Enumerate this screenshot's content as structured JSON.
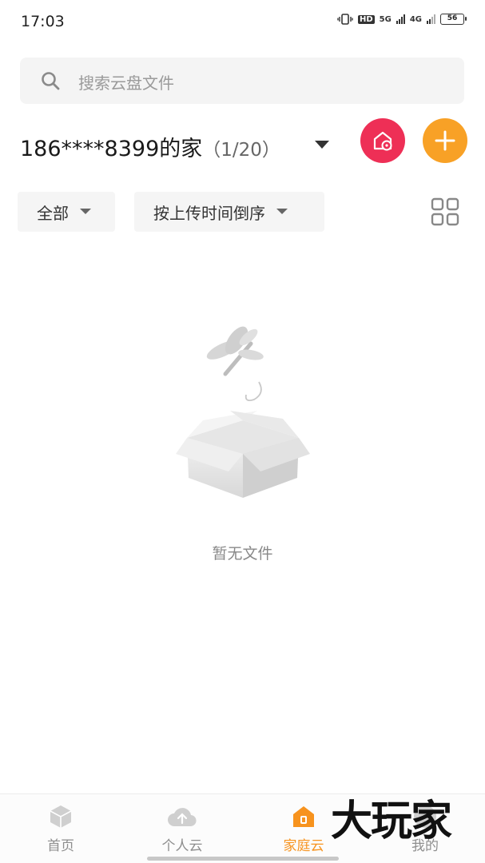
{
  "status_bar": {
    "time": "17:03",
    "hd_label": "HD",
    "net1": "5G",
    "net2": "4G",
    "battery": "56"
  },
  "search": {
    "placeholder": "搜索云盘文件",
    "icon": "search-icon"
  },
  "family": {
    "name": "186****8399的家",
    "count": "（1/20）",
    "dropdown_icon": "caret-down-icon"
  },
  "actions": {
    "home_settings_icon": "home-settings-icon",
    "add_icon": "plus-icon",
    "home_settings_color": "#ee2f56",
    "add_color": "#f8a126"
  },
  "filters": {
    "category": "全部",
    "sort": "按上传时间倒序",
    "view_toggle_icon": "grid-view-icon"
  },
  "empty_state": {
    "text": "暂无文件",
    "illustration": "empty-box-dragonfly"
  },
  "bottom_nav": {
    "items": [
      {
        "label": "首页",
        "icon": "cube-icon"
      },
      {
        "label": "个人云",
        "icon": "cloud-upload-icon"
      },
      {
        "label": "家庭云",
        "icon": "family-home-icon",
        "active": true
      },
      {
        "label": "我的",
        "icon": "profile-icon"
      }
    ],
    "active_color": "#f7931e"
  },
  "watermark": "大玩家"
}
